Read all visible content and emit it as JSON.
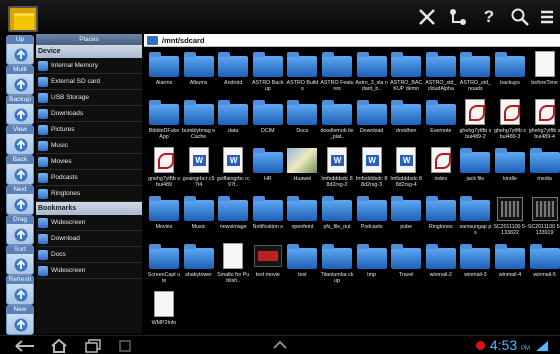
{
  "actionbar": {
    "icons": [
      "tools-icon",
      "network-icon",
      "help-icon",
      "search-icon",
      "menu-icon"
    ],
    "help_glyph": "?"
  },
  "tools": [
    {
      "label": "Up",
      "icon": "up-arrow-icon"
    },
    {
      "label": "Multi",
      "icon": "multi-select-icon"
    },
    {
      "label": "Backup",
      "icon": "backup-icon"
    },
    {
      "label": "View",
      "icon": "view-icon"
    },
    {
      "label": "Back",
      "icon": "back-arrow-icon"
    },
    {
      "label": "Next",
      "icon": "next-arrow-icon"
    },
    {
      "label": "Drag",
      "icon": "drag-icon"
    },
    {
      "label": "Sort",
      "icon": "sort-icon"
    },
    {
      "label": "Refresh",
      "icon": "refresh-icon"
    },
    {
      "label": "New",
      "icon": "new-icon"
    }
  ],
  "sidebar": {
    "header": "Places",
    "device_title": "Device",
    "device": [
      {
        "label": "Internal Memory",
        "icon": "memory-icon"
      },
      {
        "label": "External SD card",
        "icon": "sd-card-icon"
      },
      {
        "label": "USB Storage",
        "icon": "usb-icon"
      },
      {
        "label": "Downloads",
        "icon": "download-icon"
      },
      {
        "label": "Pictures",
        "icon": "camera-icon"
      },
      {
        "label": "Music",
        "icon": "music-icon"
      },
      {
        "label": "Movies",
        "icon": "movie-icon"
      },
      {
        "label": "Podcasts",
        "icon": "podcast-icon"
      },
      {
        "label": "Ringtones",
        "icon": "phone-icon"
      }
    ],
    "bookmarks_title": "Bookmarks",
    "bookmarks": [
      {
        "label": "Widescreen",
        "icon": "folder-icon"
      },
      {
        "label": "Download",
        "icon": "folder-icon"
      },
      {
        "label": "Docs",
        "icon": "folder-icon"
      },
      {
        "label": "Widescreen",
        "icon": "folder-icon"
      }
    ]
  },
  "path": "/mnt/sdcard",
  "files": [
    [
      "Alarms",
      "folder"
    ],
    [
      "Albums",
      "folder"
    ],
    [
      "Android",
      "folder"
    ],
    [
      "ASTRO Backup",
      "folder"
    ],
    [
      "ASTRO Builds",
      "folder"
    ],
    [
      "ASTRO Features",
      "folder"
    ],
    [
      "Astro_3_sla ndard_b..",
      "folder"
    ],
    [
      "ASTRO_BAC KUP demo",
      "folder"
    ],
    [
      "ASTRO_std_ cloudAlpha",
      "folder"
    ],
    [
      "ASTRO_std_ noads",
      "folder"
    ],
    [
      "backups",
      "folder"
    ],
    [
      "beforeTime",
      "doc"
    ],
    [
      "BibbleDFuke App",
      "folder"
    ],
    [
      "bumblytmag eCache",
      "folder"
    ],
    [
      "data",
      "folder"
    ],
    [
      "DCIM",
      "folder"
    ],
    [
      "Docs",
      "folder"
    ],
    [
      "doodlemob ile_plat..",
      "folder"
    ],
    [
      "Download",
      "folder"
    ],
    [
      "droidhen",
      "folder"
    ],
    [
      "Evernote",
      "folder"
    ],
    [
      "ghehg7ytftb sbui489-2",
      "pdf"
    ],
    [
      "ghehg7ytftb sbui489-3",
      "pdf"
    ],
    [
      "ghehg7ytftb sbui489-4",
      "pdf"
    ],
    [
      "gnehg7ytftb sbui489",
      "pdf"
    ],
    [
      "gvaingrbcr c97t4",
      "word"
    ],
    [
      "gviffaingrbc rc97t..",
      "word"
    ],
    [
      "HR",
      "folder"
    ],
    [
      "Huawei",
      "img"
    ],
    [
      "Imfsdddsdc 88d2rsg-2",
      "word"
    ],
    [
      "Imfsdddsdc 88d2rsg-3",
      "word"
    ],
    [
      "Imfsdddsdc 88d2rsg-4",
      "word"
    ],
    [
      "index",
      "pdf"
    ],
    [
      "jack file",
      "folder"
    ],
    [
      "kindle",
      "folder"
    ],
    [
      "media",
      "folder"
    ],
    [
      "Movies",
      "folder"
    ],
    [
      "Music",
      "folder"
    ],
    [
      "newsimage",
      "folder"
    ],
    [
      "Notification s",
      "folder"
    ],
    [
      "openfeint",
      "folder"
    ],
    [
      "pfs_file_out",
      "folder"
    ],
    [
      "Podcasts",
      "folder"
    ],
    [
      "pube",
      "folder"
    ],
    [
      "Ringtones",
      "folder"
    ],
    [
      "samsungap ps",
      "folder"
    ],
    [
      "SC2011100 5-133822",
      "apk"
    ],
    [
      "SC2011100 5-133919",
      "apk"
    ],
    [
      "ScreenCapt ure",
      "folder"
    ],
    [
      "shakytower",
      "folder"
    ],
    [
      "Smalto for Publish..",
      "doc"
    ],
    [
      "test movie",
      "vid"
    ],
    [
      "test",
      "folder"
    ],
    [
      "Titaniumba ckup",
      "folder"
    ],
    [
      "tmp",
      "folder"
    ],
    [
      "Travel",
      "folder"
    ],
    [
      "winmail-2",
      "folder"
    ],
    [
      "winmail-3",
      "folder"
    ],
    [
      "winmail-4",
      "folder"
    ],
    [
      "winmail-5",
      "folder"
    ],
    [
      "WMP2Info",
      "doc"
    ]
  ],
  "navbar": {
    "clock": "4:53",
    "ampm": "PM",
    "icons": [
      "back-icon",
      "home-icon",
      "recent-apps-icon",
      "screenshot-icon"
    ]
  }
}
